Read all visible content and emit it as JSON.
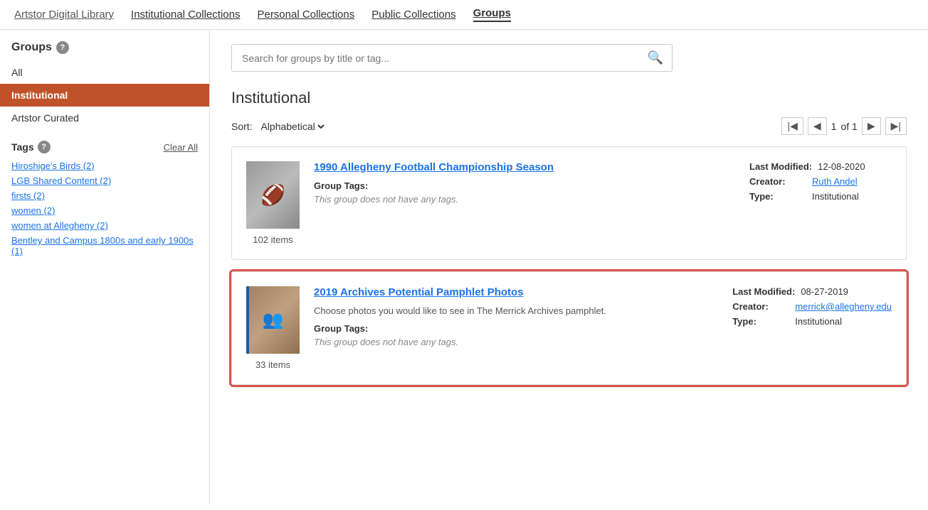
{
  "nav": {
    "artstor_label": "Artstor Digital Library",
    "institutional_collections_label": "Institutional Collections",
    "personal_collections_label": "Personal Collections",
    "public_collections_label": "Public Collections",
    "groups_label": "Groups"
  },
  "sidebar": {
    "groups_label": "Groups",
    "help_icon_label": "?",
    "items": [
      {
        "id": "all",
        "label": "All",
        "active": false
      },
      {
        "id": "institutional",
        "label": "Institutional",
        "active": true
      },
      {
        "id": "artstor-curated",
        "label": "Artstor Curated",
        "active": false
      }
    ],
    "tags_label": "Tags",
    "clear_all_label": "Clear All",
    "tags": [
      {
        "label": "Hiroshige's Birds (2)"
      },
      {
        "label": "LGB Shared Content (2)"
      },
      {
        "label": "firsts (2)"
      },
      {
        "label": "women (2)"
      },
      {
        "label": "women at Allegheny (2)"
      },
      {
        "label": "Bentley and Campus 1800s and early 1900s (1)"
      }
    ]
  },
  "search": {
    "placeholder": "Search for groups by title or tag..."
  },
  "main": {
    "section_title": "Institutional",
    "sort_label": "Sort:",
    "sort_value": "Alphabetical",
    "pagination": {
      "current_page": "1",
      "of_label": "of 1"
    },
    "groups": [
      {
        "id": "group1",
        "title": "1990 Allegheny Football Championship Season",
        "description": "",
        "items_count": "102 items",
        "tags_label": "Group Tags:",
        "tags_value": "This group does not have any tags.",
        "last_modified_label": "Last Modified:",
        "last_modified_value": "12-08-2020",
        "creator_label": "Creator:",
        "creator_value": "Ruth Andel",
        "type_label": "Type:",
        "type_value": "Institutional",
        "highlighted": false,
        "thumb_type": "football"
      },
      {
        "id": "group2",
        "title": "2019 Archives Potential Pamphlet Photos",
        "description": "Choose photos you would like to see in The Merrick Archives pamphlet.",
        "items_count": "33 items",
        "tags_label": "Group Tags:",
        "tags_value": "This group does not have any tags.",
        "last_modified_label": "Last Modified:",
        "last_modified_value": "08-27-2019",
        "creator_label": "Creator:",
        "creator_value": "merrick@allegheny.edu",
        "type_label": "Type:",
        "type_value": "Institutional",
        "highlighted": true,
        "thumb_type": "archive"
      }
    ]
  }
}
